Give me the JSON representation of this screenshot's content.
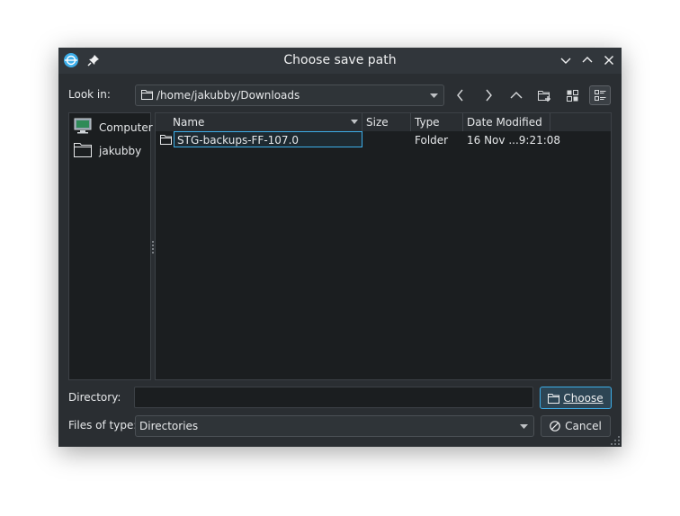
{
  "window": {
    "title": "Choose save path"
  },
  "toolbar": {
    "look_in_label": "Look in:",
    "path": "/home/jakubby/Downloads"
  },
  "places": [
    {
      "label": "Computer",
      "icon": "computer-icon"
    },
    {
      "label": "jakubby",
      "icon": "home-folder-icon"
    }
  ],
  "file_list": {
    "columns": [
      "Name",
      "Size",
      "Type",
      "Date Modified"
    ],
    "rows": [
      {
        "name": "STG-backups-FF-107.0",
        "size": "",
        "type": "Folder",
        "date_modified": "16 Nov ...9:21:08"
      }
    ]
  },
  "footer": {
    "directory_label": "Directory:",
    "directory_value": "",
    "choose_label": "Choose",
    "files_of_type_label": "Files of type:",
    "files_of_type_value": "Directories",
    "cancel_label": "Cancel"
  },
  "colors": {
    "accent": "#3daee9",
    "window_bg": "#2a2e32",
    "view_bg": "#1b1e20"
  }
}
